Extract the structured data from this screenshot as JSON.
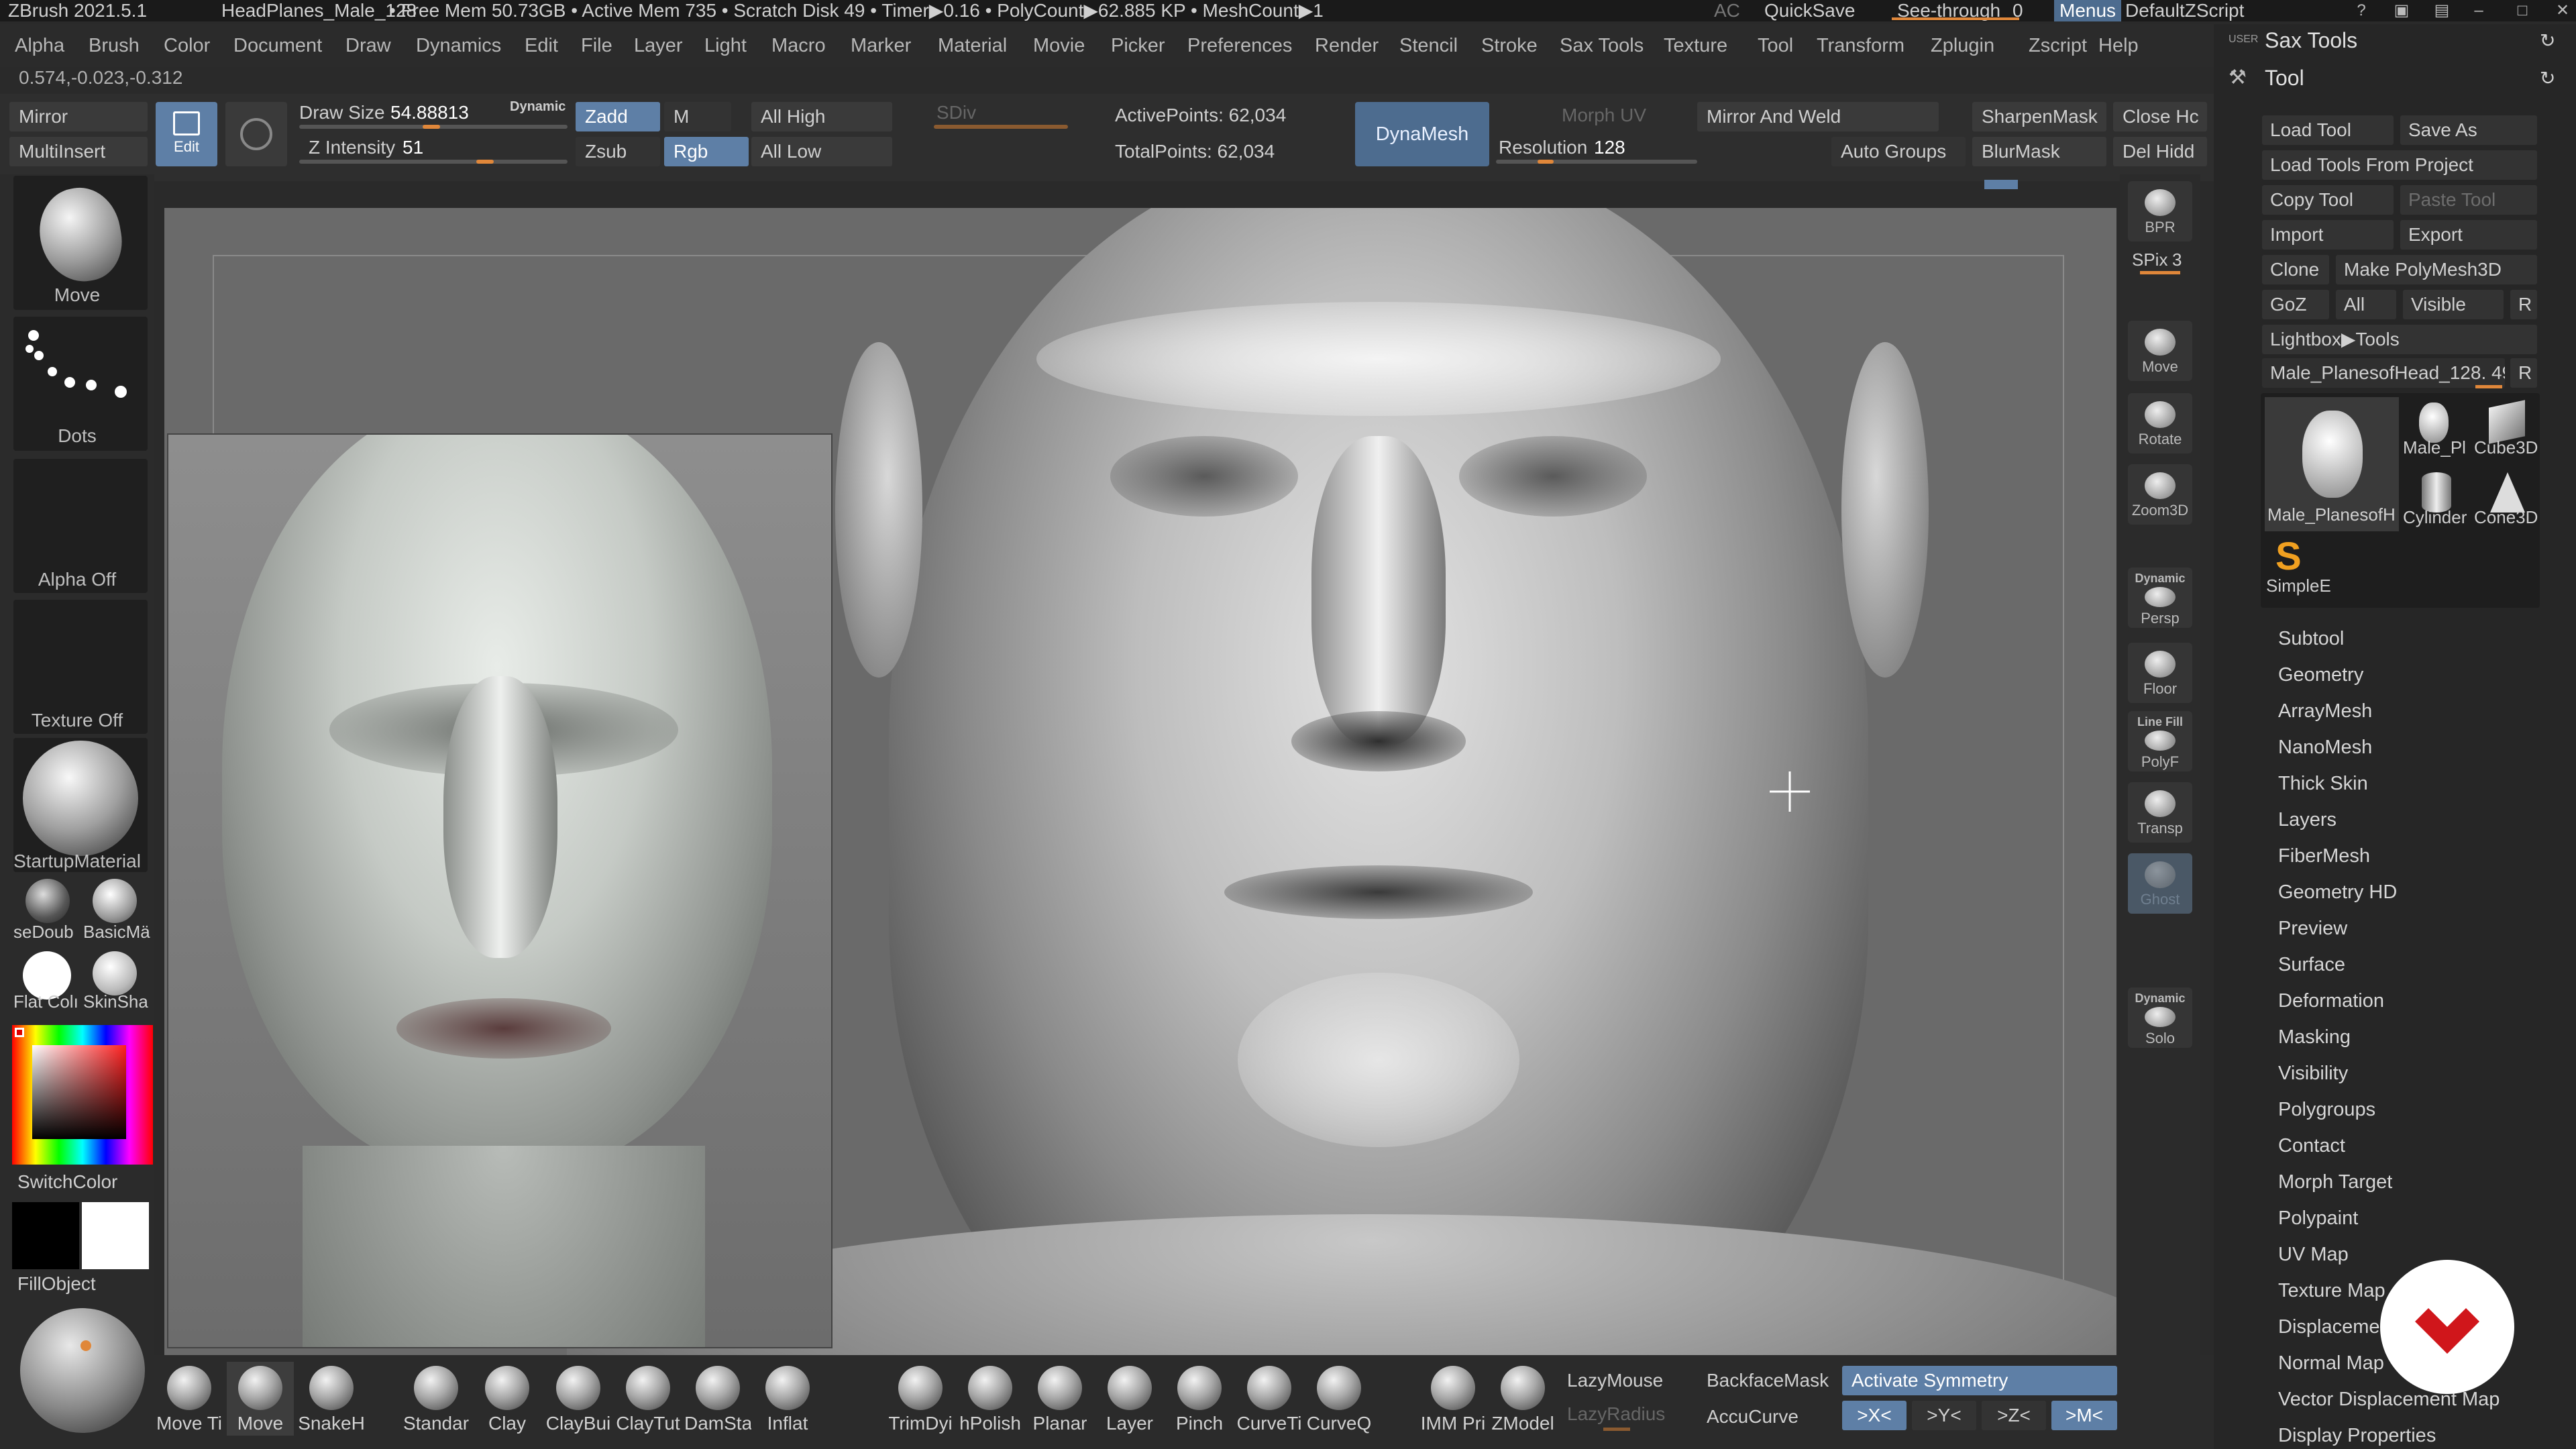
{
  "titlebar": {
    "app": "ZBrush 2021.5.1",
    "file": "HeadPlanes_Male_128",
    "stats": "• Free Mem 50.73GB • Active Mem 735 • Scratch Disk 49 •  Timer▶0.16 • PolyCount▶62.885 KP • MeshCount▶1",
    "ac": "AC",
    "quicksave": "QuickSave",
    "seethrough_label": "See-through",
    "seethrough_value": "0",
    "menus": "Menus",
    "script": "DefaultZScript"
  },
  "menubar": [
    "Alpha",
    "Brush",
    "Color",
    "Document",
    "Draw",
    "Dynamics",
    "Edit",
    "File",
    "Layer",
    "Light",
    "Macro",
    "Marker",
    "Material",
    "Movie",
    "Picker",
    "Preferences",
    "Render",
    "Stencil",
    "Stroke",
    "Sax Tools",
    "Texture",
    "Tool",
    "Transform",
    "Zplugin",
    "Zscript",
    "Help"
  ],
  "coords": "0.574,-0.023,-0.312",
  "topshelf": {
    "mirror": "Mirror",
    "multiinsert": "MultiInsert",
    "edit": "Edit",
    "draw_size_label": "Draw Size",
    "draw_size_value": "54.88813",
    "dynamic": "Dynamic",
    "z_intensity_label": "Z Intensity",
    "z_intensity_value": "51",
    "zadd": "Zadd",
    "zsub": "Zsub",
    "m": "M",
    "rgb": "Rgb",
    "all_high": "All High",
    "all_low": "All Low",
    "sdiv": "SDiv",
    "active_points": "ActivePoints: 62,034",
    "total_points": "TotalPoints: 62,034",
    "dynamesh": "DynaMesh",
    "morph_uv": "Morph UV",
    "resolution_label": "Resolution",
    "resolution_value": "128",
    "mirror_and_weld": "Mirror And Weld",
    "auto_groups": "Auto Groups",
    "sharpen_mask": "SharpenMask",
    "blur_mask": "BlurMask",
    "close_hc": "Close Hc",
    "del_hidd": "Del Hidd"
  },
  "leftpanel": {
    "move": "Move",
    "dots": "Dots",
    "alpha_off": "Alpha Off",
    "texture_off": "Texture Off",
    "startup_material": "StartupMaterial",
    "mat1": "seDoub",
    "mat2": "BasicMä",
    "mat3": "Flat Colı",
    "mat4": "SkinSha",
    "switch_color": "SwitchColor",
    "fill_object": "FillObject",
    "colors": {
      "main": "#000000",
      "secondary": "#ffffff"
    }
  },
  "rightstrip": {
    "bpr": "BPR",
    "spix_label": "SPix",
    "spix_value": "3",
    "move": "Move",
    "rotate": "Rotate",
    "zoom3d": "Zoom3D",
    "dynamic": "Dynamic",
    "persp": "Persp",
    "floor": "Floor",
    "line_fill": "Line Fill",
    "polyf": "PolyF",
    "transp": "Transp",
    "ghost": "Ghost",
    "solo_dynamic": "Dynamic",
    "solo": "Solo"
  },
  "rightpanel": {
    "user_tag": "USER",
    "sax_tools": "Sax Tools",
    "tool_title": "Tool",
    "load_tool": "Load Tool",
    "save_as": "Save As",
    "load_from_project": "Load Tools From Project",
    "copy_tool": "Copy Tool",
    "paste_tool": "Paste Tool",
    "import": "Import",
    "export": "Export",
    "clone": "Clone",
    "make_polymesh": "Make PolyMesh3D",
    "goz": "GoZ",
    "all": "All",
    "visible": "Visible",
    "r": "R",
    "lightbox_tools": "Lightbox▶Tools",
    "current_tool": "Male_PlanesofHead_128. 49",
    "tool_thumbs": [
      "Male_PlanesofH",
      "Male_Pl",
      "Cube3D",
      "Cylinder",
      "Cone3D",
      "SimpleE"
    ],
    "subpalettes": [
      "Subtool",
      "Geometry",
      "ArrayMesh",
      "NanoMesh",
      "Thick Skin",
      "Layers",
      "FiberMesh",
      "Geometry HD",
      "Preview",
      "Surface",
      "Deformation",
      "Masking",
      "Visibility",
      "Polygroups",
      "Contact",
      "Morph Target",
      "Polypaint",
      "UV Map",
      "Texture Map",
      "Displacement",
      "Normal Map",
      "Vector Displacement Map",
      "Display Properties"
    ]
  },
  "bottomshelf": {
    "brushes": [
      "Move Ti",
      "Move",
      "SnakeH",
      "Standar",
      "Clay",
      "ClayBui",
      "ClayTut",
      "DamSta",
      "Inflat",
      "TrimDyi",
      "hPolish",
      "Planar",
      "Layer",
      "Pinch",
      "CurveTi",
      "CurveQ",
      "IMM Pri",
      "ZModel"
    ],
    "lazymouse": "LazyMouse",
    "lazyradius": "LazyRadius",
    "backface_mask": "BackfaceMask",
    "accucurve": "AccuCurve",
    "activate_symmetry": "Activate Symmetry",
    "sym_x": ">X<",
    "sym_y": ">Y<",
    "sym_z": ">Z<",
    "sym_m": ">M<"
  },
  "accent_colors": {
    "orange": "#e0873a",
    "blue": "#5e7fa6",
    "brand_red": "#d0161b"
  }
}
